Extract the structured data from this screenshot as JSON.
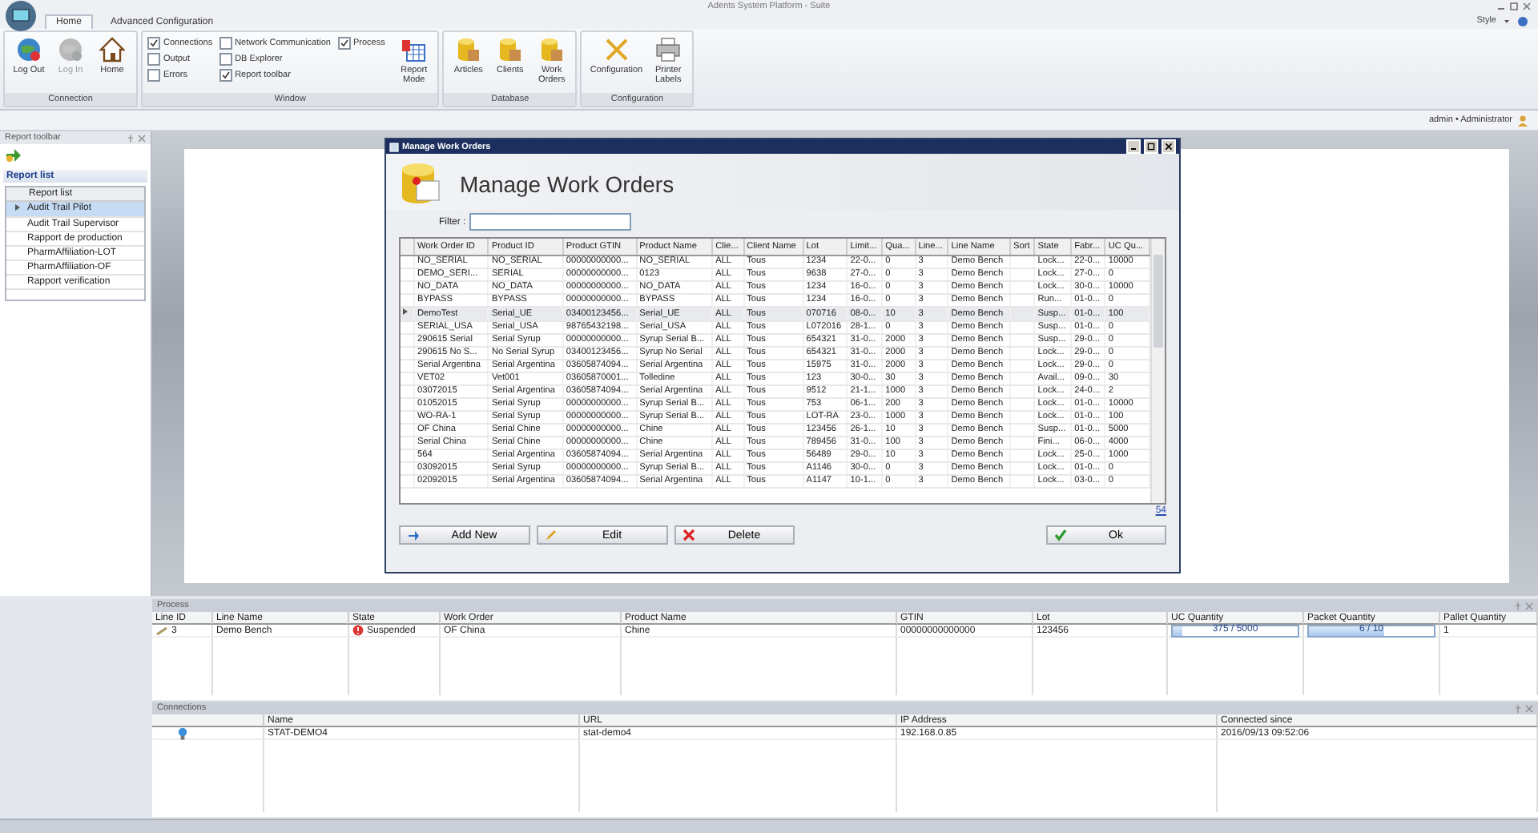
{
  "window": {
    "title": "Adents System Platform - Suite",
    "style_menu": "Style"
  },
  "ribbon": {
    "tabs": [
      {
        "label": "Home",
        "selected": true
      },
      {
        "label": "Advanced Configuration",
        "selected": false
      }
    ],
    "groups": [
      {
        "title": "Connection",
        "buttons": [
          {
            "label": "Log Out",
            "disabled": false
          },
          {
            "label": "Log In",
            "disabled": true
          },
          {
            "label": "Home",
            "disabled": false
          }
        ]
      },
      {
        "title": "Window",
        "checkboxes": [
          {
            "label": "Connections",
            "checked": true
          },
          {
            "label": "Output",
            "checked": false
          },
          {
            "label": "Errors",
            "checked": false
          },
          {
            "label": "Network Communication",
            "checked": false
          },
          {
            "label": "DB Explorer",
            "checked": false
          },
          {
            "label": "Report toolbar",
            "checked": true
          },
          {
            "label": "Process",
            "checked": true
          }
        ],
        "buttons": [
          {
            "label": "Report Mode",
            "disabled": false
          }
        ]
      },
      {
        "title": "Database",
        "buttons": [
          {
            "label": "Articles",
            "disabled": false
          },
          {
            "label": "Clients",
            "disabled": false
          },
          {
            "label": "Work Orders",
            "disabled": false
          }
        ]
      },
      {
        "title": "Configuration",
        "buttons": [
          {
            "label": "Configuration",
            "disabled": false
          },
          {
            "label": "Printer Labels",
            "disabled": false
          }
        ]
      }
    ]
  },
  "user": "admin • Administrator",
  "report_toolbar": {
    "title": "Report toolbar",
    "section": "Report list",
    "list_header": "Report list",
    "items": [
      {
        "label": "Audit Trail Pilot",
        "selected": true
      },
      {
        "label": "Audit Trail Supervisor",
        "selected": false
      },
      {
        "label": "Rapport de production",
        "selected": false
      },
      {
        "label": "PharmAffiliation-LOT",
        "selected": false
      },
      {
        "label": "PharmAffiliation-OF",
        "selected": false
      },
      {
        "label": "Rapport verification",
        "selected": false
      }
    ]
  },
  "dialog": {
    "title": "Manage Work Orders",
    "heading": "Manage Work Orders",
    "filter_label": "Filter :",
    "columns": [
      "Work Order ID",
      "Product ID",
      "Product GTIN",
      "Product Name",
      "Clie...",
      "Client Name",
      "Lot",
      "Limit...",
      "Qua...",
      "Line...",
      "Line Name",
      "Sort",
      "State",
      "Fabr...",
      "UC Qu..."
    ],
    "rows": [
      {
        "selected": false,
        "cells": [
          "NO_SERIAL",
          "NO_SERIAL",
          "00000000000...",
          "NO_SERIAL",
          "ALL",
          "Tous",
          "1234",
          "22-0...",
          "0",
          "3",
          "Demo Bench",
          "",
          "Lock...",
          "22-0...",
          "10000"
        ]
      },
      {
        "selected": false,
        "cells": [
          "DEMO_SERI...",
          "SERIAL",
          "00000000000...",
          "0123",
          "ALL",
          "Tous",
          "9638",
          "27-0...",
          "0",
          "3",
          "Demo Bench",
          "",
          "Lock...",
          "27-0...",
          "0"
        ]
      },
      {
        "selected": false,
        "cells": [
          "NO_DATA",
          "NO_DATA",
          "00000000000...",
          "NO_DATA",
          "ALL",
          "Tous",
          "1234",
          "16-0...",
          "0",
          "3",
          "Demo Bench",
          "",
          "Lock...",
          "30-0...",
          "10000"
        ]
      },
      {
        "selected": false,
        "cells": [
          "BYPASS",
          "BYPASS",
          "00000000000...",
          "BYPASS",
          "ALL",
          "Tous",
          "1234",
          "16-0...",
          "0",
          "3",
          "Demo Bench",
          "",
          "Run...",
          "01-0...",
          "0"
        ]
      },
      {
        "selected": true,
        "cells": [
          "DemoTest",
          "Serial_UE",
          "03400123456...",
          "Serial_UE",
          "ALL",
          "Tous",
          "070716",
          "08-0...",
          "10",
          "3",
          "Demo Bench",
          "",
          "Susp...",
          "01-0...",
          "100"
        ]
      },
      {
        "selected": false,
        "cells": [
          "SERIAL_USA",
          "Serial_USA",
          "98765432198...",
          "Serial_USA",
          "ALL",
          "Tous",
          "L072016",
          "28-1...",
          "0",
          "3",
          "Demo Bench",
          "",
          "Susp...",
          "01-0...",
          "0"
        ]
      },
      {
        "selected": false,
        "cells": [
          "290615 Serial",
          "Serial Syrup",
          "00000000000...",
          "Syrup Serial B...",
          "ALL",
          "Tous",
          "654321",
          "31-0...",
          "2000",
          "3",
          "Demo Bench",
          "",
          "Susp...",
          "29-0...",
          "0"
        ]
      },
      {
        "selected": false,
        "cells": [
          "290615 No S...",
          "No Serial Syrup",
          "03400123456...",
          "Syrup No Serial",
          "ALL",
          "Tous",
          "654321",
          "31-0...",
          "2000",
          "3",
          "Demo Bench",
          "",
          "Lock...",
          "29-0...",
          "0"
        ]
      },
      {
        "selected": false,
        "cells": [
          "Serial Argentina",
          "Serial Argentina",
          "03605874094...",
          "Serial Argentina",
          "ALL",
          "Tous",
          "15975",
          "31-0...",
          "2000",
          "3",
          "Demo Bench",
          "",
          "Lock...",
          "29-0...",
          "0"
        ]
      },
      {
        "selected": false,
        "cells": [
          "VET02",
          "Vet001",
          "03605870001...",
          "Tolledine",
          "ALL",
          "Tous",
          "123",
          "30-0...",
          "30",
          "3",
          "Demo Bench",
          "",
          "Avail...",
          "09-0...",
          "30"
        ]
      },
      {
        "selected": false,
        "cells": [
          "03072015",
          "Serial Argentina",
          "03605874094...",
          "Serial Argentina",
          "ALL",
          "Tous",
          "9512",
          "21-1...",
          "1000",
          "3",
          "Demo Bench",
          "",
          "Lock...",
          "24-0...",
          "2"
        ]
      },
      {
        "selected": false,
        "cells": [
          "01052015",
          "Serial Syrup",
          "00000000000...",
          "Syrup Serial B...",
          "ALL",
          "Tous",
          "753",
          "06-1...",
          "200",
          "3",
          "Demo Bench",
          "",
          "Lock...",
          "01-0...",
          "10000"
        ]
      },
      {
        "selected": false,
        "cells": [
          "WO-RA-1",
          "Serial Syrup",
          "00000000000...",
          "Syrup Serial B...",
          "ALL",
          "Tous",
          "LOT-RA",
          "23-0...",
          "1000",
          "3",
          "Demo Bench",
          "",
          "Lock...",
          "01-0...",
          "100"
        ]
      },
      {
        "selected": false,
        "cells": [
          "OF China",
          "Serial Chine",
          "00000000000...",
          "Chine",
          "ALL",
          "Tous",
          "123456",
          "26-1...",
          "10",
          "3",
          "Demo Bench",
          "",
          "Susp...",
          "01-0...",
          "5000"
        ]
      },
      {
        "selected": false,
        "cells": [
          "Serial China",
          "Serial Chine",
          "00000000000...",
          "Chine",
          "ALL",
          "Tous",
          "789456",
          "31-0...",
          "100",
          "3",
          "Demo Bench",
          "",
          "Fini...",
          "06-0...",
          "4000"
        ]
      },
      {
        "selected": false,
        "cells": [
          "564",
          "Serial Argentina",
          "03605874094...",
          "Serial Argentina",
          "ALL",
          "Tous",
          "56489",
          "29-0...",
          "10",
          "3",
          "Demo Bench",
          "",
          "Lock...",
          "25-0...",
          "1000"
        ]
      },
      {
        "selected": false,
        "cells": [
          "03092015",
          "Serial Syrup",
          "00000000000...",
          "Syrup Serial B...",
          "ALL",
          "Tous",
          "A1146",
          "30-0...",
          "0",
          "3",
          "Demo Bench",
          "",
          "Lock...",
          "01-0...",
          "0"
        ]
      },
      {
        "selected": false,
        "cells": [
          "02092015",
          "Serial Argentina",
          "03605874094...",
          "Serial Argentina",
          "ALL",
          "Tous",
          "A1147",
          "10-1...",
          "0",
          "3",
          "Demo Bench",
          "",
          "Lock...",
          "03-0...",
          "0"
        ]
      }
    ],
    "count": "54",
    "buttons": [
      {
        "kind": "add",
        "label": "Add New"
      },
      {
        "kind": "edit",
        "label": "Edit"
      },
      {
        "kind": "delete",
        "label": "Delete"
      },
      {
        "kind": "ok",
        "label": "Ok"
      }
    ]
  },
  "process": {
    "title": "Process",
    "columns": [
      "Line ID",
      "Line Name",
      "State",
      "Work Order",
      "Product Name",
      "GTIN",
      "Lot",
      "UC Quantity",
      "Packet Quantity",
      "Pallet Quantity"
    ],
    "row": {
      "line_id": "3",
      "line_name": "Demo Bench",
      "state": "Suspended",
      "work_order": "OF China",
      "product_name": "Chine",
      "gtin": "00000000000000",
      "lot": "123456",
      "uc_quantity": {
        "reading": "375 / 5000",
        "level": 0.075
      },
      "packet_quantity": {
        "reading": "6 / 10",
        "level": 0.6
      },
      "pallet_quantity": "1"
    }
  },
  "connections": {
    "title": "Connections",
    "columns": [
      "Name",
      "URL",
      "IP Address",
      "Connected since"
    ],
    "row": {
      "name": "STAT-DEMO4",
      "url": "stat-demo4",
      "ip": "192.168.0.85",
      "since": "2016/09/13 09:52:06"
    }
  }
}
